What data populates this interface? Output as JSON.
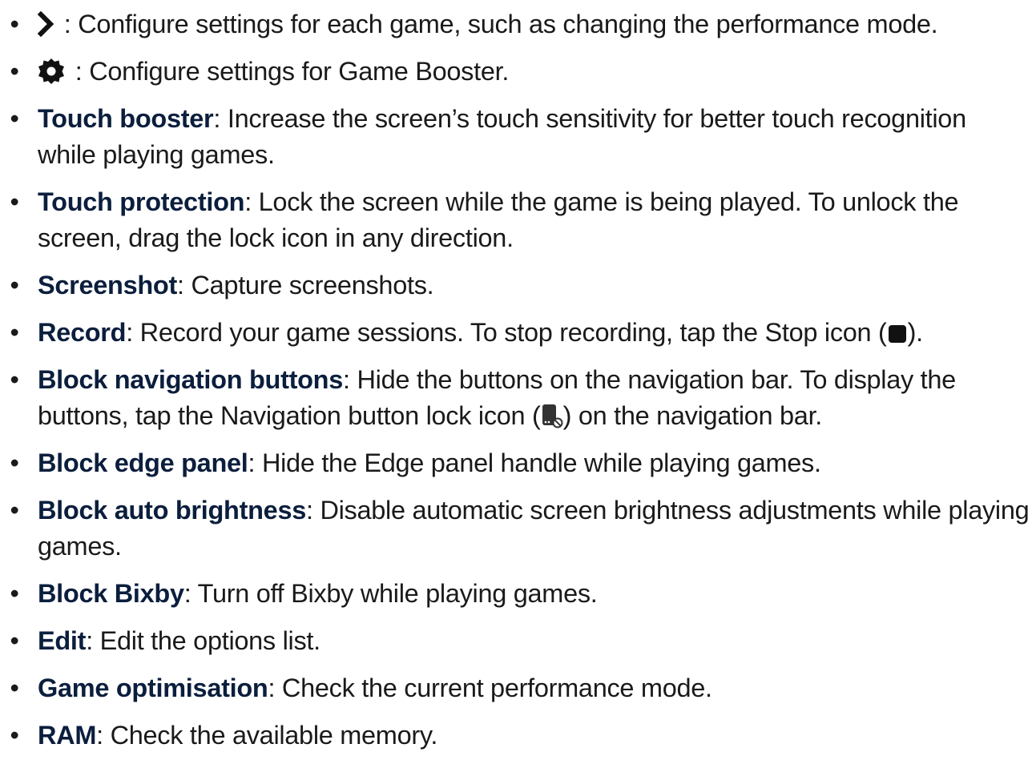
{
  "bullet_glyph": "•",
  "items": [
    {
      "icon": "chevron-right-icon",
      "desc": " : Configure settings for each game, such as changing the performance mode."
    },
    {
      "icon": "gear-icon",
      "desc": " : Configure settings for Game Booster."
    },
    {
      "term": "Touch booster",
      "desc": ": Increase the screen’s touch sensitivity for better touch recognition while playing games."
    },
    {
      "term": "Touch protection",
      "desc": ": Lock the screen while the game is being played. To unlock the screen, drag the lock icon in any direction."
    },
    {
      "term": "Screenshot",
      "desc": ": Capture screenshots."
    },
    {
      "term": "Record",
      "desc_before": ": Record your game sessions. To stop recording, tap the Stop icon (",
      "icon": "stop-icon",
      "desc_after": ")."
    },
    {
      "term": "Block navigation buttons",
      "desc_before": ": Hide the buttons on the navigation bar. To display the buttons, tap the Navigation button lock icon (",
      "icon": "navigation-button-lock-icon",
      "desc_after": ") on the navigation bar."
    },
    {
      "term": "Block edge panel",
      "desc": ": Hide the Edge panel handle while playing games."
    },
    {
      "term": "Block auto brightness",
      "desc": ": Disable automatic screen brightness adjustments while playing games."
    },
    {
      "term": "Block Bixby",
      "desc": ": Turn off Bixby while playing games."
    },
    {
      "term": "Edit",
      "desc": ": Edit the options list."
    },
    {
      "term": "Game optimisation",
      "desc": ": Check the current performance mode."
    },
    {
      "term": "RAM",
      "desc": ": Check the available memory."
    }
  ],
  "colors": {
    "text": "#1a1a1a",
    "term": "#0b1e3d",
    "icon": "#111111"
  }
}
